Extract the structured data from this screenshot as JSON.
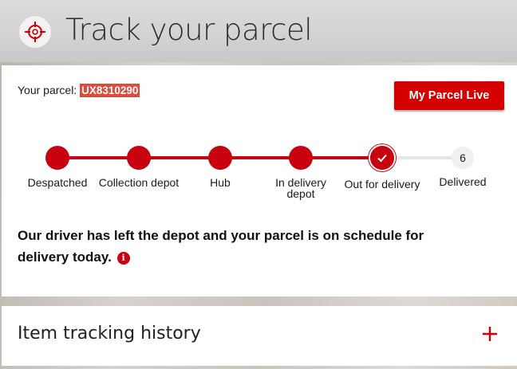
{
  "header": {
    "title": "Track your parcel",
    "logo_icon": "crosshair-icon",
    "accent_color": "#d40000"
  },
  "parcel": {
    "label": "Your parcel:",
    "id": "UX8310290",
    "live_button_label": "My Parcel Live"
  },
  "progress": {
    "current_step": 5,
    "steps": [
      {
        "label": "Despatched",
        "state": "done"
      },
      {
        "label": "Collection depot",
        "state": "done"
      },
      {
        "label": "Hub",
        "state": "done"
      },
      {
        "label": "In delivery depot",
        "state": "done"
      },
      {
        "label": "Out for delivery",
        "state": "current",
        "icon": "check-icon"
      },
      {
        "label": "Delivered",
        "state": "pending",
        "number": "6"
      }
    ]
  },
  "status": {
    "message": "Our driver has left the depot and your parcel is on schedule for delivery today.",
    "info_icon": "info-icon"
  },
  "history": {
    "title": "Item tracking history",
    "expand_icon": "plus-icon"
  }
}
